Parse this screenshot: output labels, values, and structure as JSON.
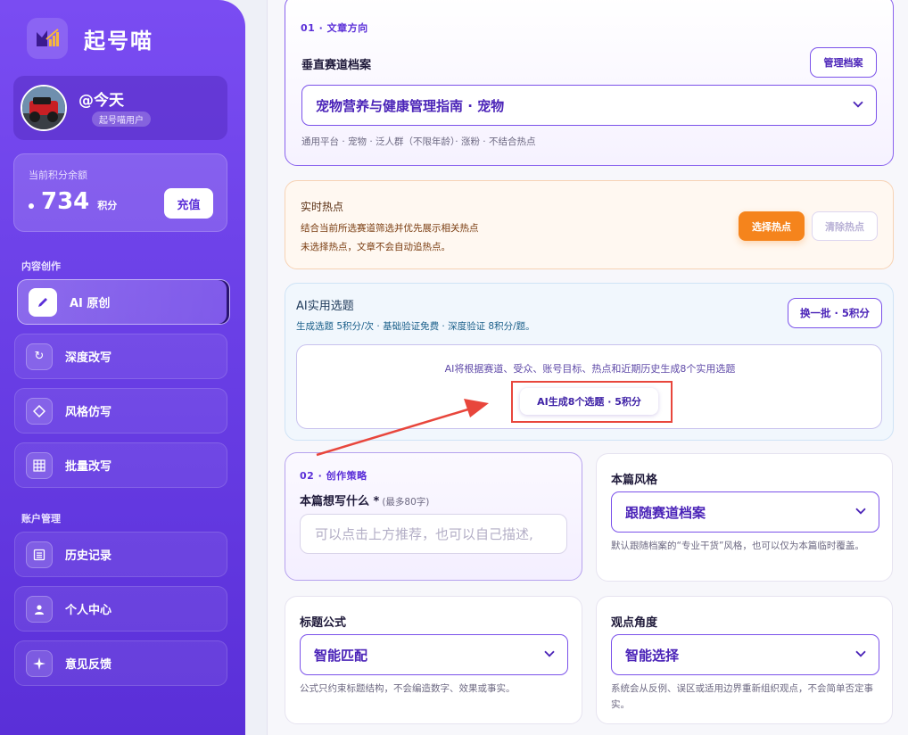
{
  "app": {
    "name": "起号喵"
  },
  "user": {
    "name": "@今天",
    "role": "起号喵用户"
  },
  "points": {
    "label": "当前积分余额",
    "value": "734",
    "unit": "积分",
    "recharge": "充值"
  },
  "sidebar": {
    "section_content": "内容创作",
    "section_account": "账户管理",
    "items": [
      {
        "label": "AI 原创",
        "icon": "pen-icon"
      },
      {
        "label": "深度改写",
        "icon": "refresh-icon"
      },
      {
        "label": "风格仿写",
        "icon": "diamond-icon"
      },
      {
        "label": "批量改写",
        "icon": "grid-icon"
      },
      {
        "label": "历史记录",
        "icon": "list-icon"
      },
      {
        "label": "个人中心",
        "icon": "user-icon"
      },
      {
        "label": "意见反馈",
        "icon": "sparkle-icon"
      }
    ]
  },
  "direction": {
    "step": "01 · 文章方向",
    "label": "垂直赛道档案",
    "manage_btn": "管理档案",
    "selected": "宠物营养与健康管理指南 · 宠物",
    "hint": "通用平台 · 宠物 · 泛人群（不限年龄）· 涨粉 · 不结合热点"
  },
  "hot": {
    "title": "实时热点",
    "line1": "结合当前所选赛道筛选并优先展示相关热点",
    "line2": "未选择热点，文章不会自动追热点。",
    "select_btn": "选择热点",
    "clear_btn": "清除热点"
  },
  "topics": {
    "title": "AI实用选题",
    "sub": "生成选题 5积分/次 · 基础验证免费 · 深度验证 8积分/题。",
    "refresh_btn": "换一批 · 5积分",
    "hint": "AI将根据赛道、受众、账号目标、热点和近期历史生成8个实用选题",
    "generate_btn": "AI生成8个选题 · 5积分"
  },
  "strategy": {
    "step": "02 · 创作策略",
    "label": "本篇想写什么 *",
    "limit": "(最多80字)",
    "placeholder": "可以点击上方推荐，也可以自己描述,"
  },
  "style": {
    "label": "本篇风格",
    "selected": "跟随赛道档案",
    "hint": "默认跟随档案的“专业干货”风格，也可以仅为本篇临时覆盖。"
  },
  "title_formula": {
    "label": "标题公式",
    "selected": "智能匹配",
    "hint": "公式只约束标题结构，不会编造数字、效果或事实。"
  },
  "viewpoint": {
    "label": "观点角度",
    "selected": "智能选择",
    "hint": "系统会从反例、误区或适用边界重新组织观点，不会简单否定事实。"
  }
}
